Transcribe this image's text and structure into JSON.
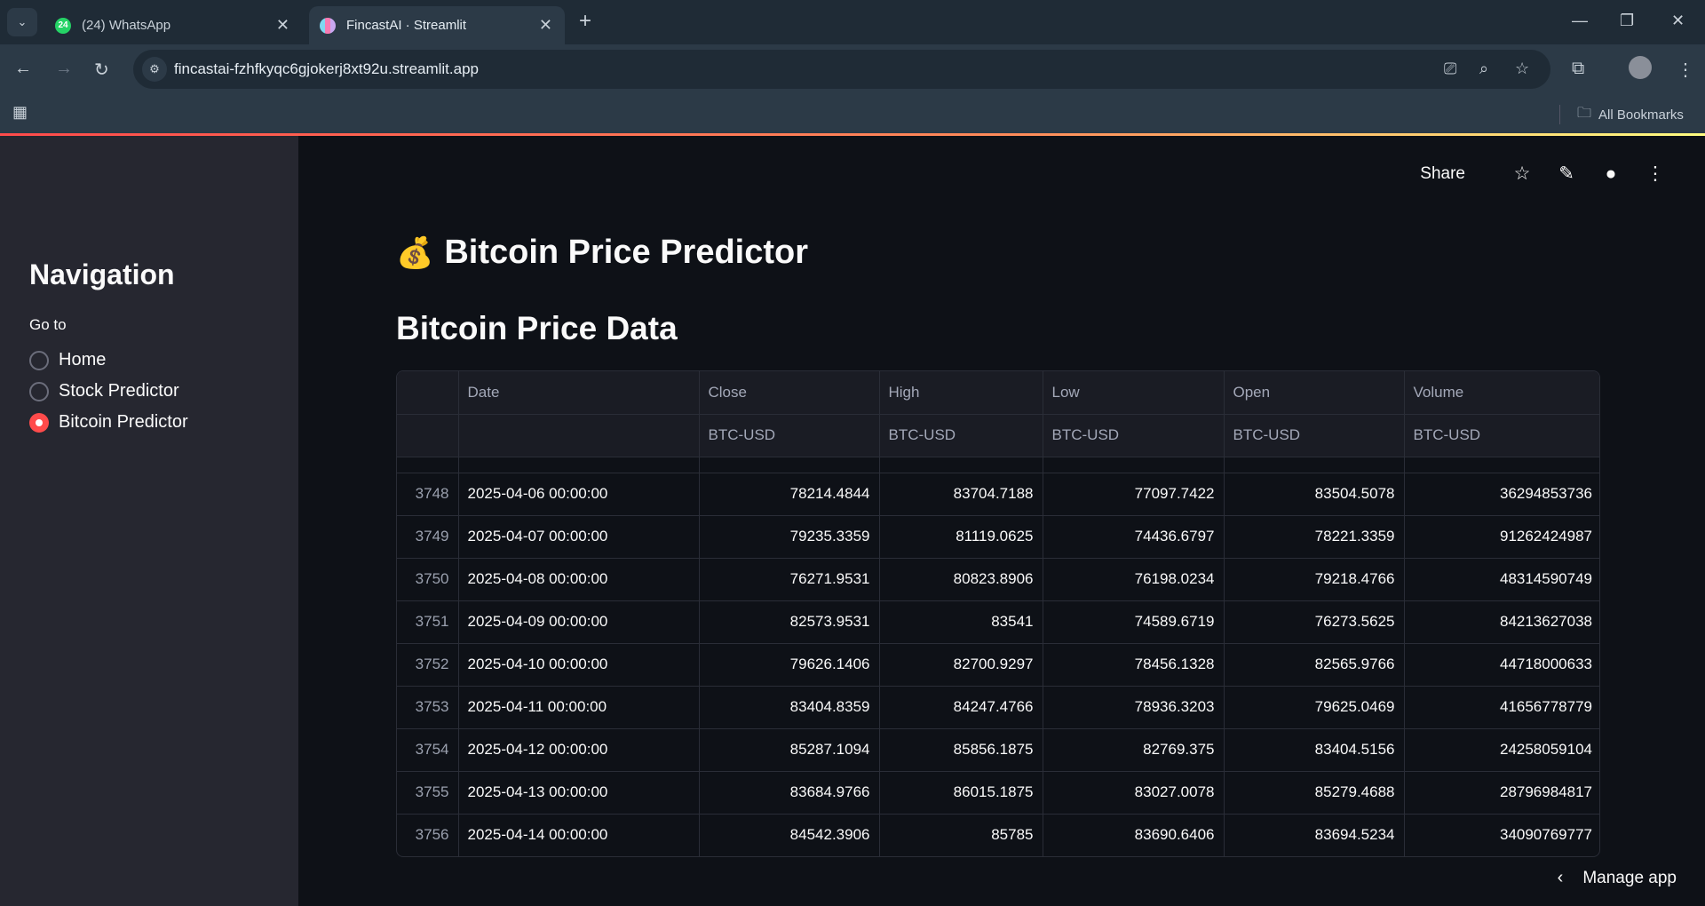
{
  "browser": {
    "tabs": [
      {
        "title": "(24) WhatsApp",
        "badge": "24"
      },
      {
        "title": "FincastAI · Streamlit"
      }
    ],
    "url": "fincastai-fzhfkyqc6gjokerj8xt92u.streamlit.app",
    "bookmarks_label": "All Bookmarks"
  },
  "sidebar": {
    "title": "Navigation",
    "goto_label": "Go to",
    "options": [
      {
        "label": "Home",
        "selected": false
      },
      {
        "label": "Stock Predictor",
        "selected": false
      },
      {
        "label": "Bitcoin Predictor",
        "selected": true
      }
    ]
  },
  "toolbar": {
    "share_label": "Share"
  },
  "page": {
    "title": "Bitcoin Price Predictor",
    "title_icon": "💰",
    "section_title": "Bitcoin Price Data"
  },
  "table": {
    "columns": [
      "",
      "Date",
      "Close",
      "High",
      "Low",
      "Open",
      "Volume"
    ],
    "subheaders": [
      "",
      "",
      "BTC-USD",
      "BTC-USD",
      "BTC-USD",
      "BTC-USD",
      "BTC-USD"
    ],
    "rows": [
      [
        "3748",
        "2025-04-06 00:00:00",
        "78214.4844",
        "83704.7188",
        "77097.7422",
        "83504.5078",
        "36294853736"
      ],
      [
        "3749",
        "2025-04-07 00:00:00",
        "79235.3359",
        "81119.0625",
        "74436.6797",
        "78221.3359",
        "91262424987"
      ],
      [
        "3750",
        "2025-04-08 00:00:00",
        "76271.9531",
        "80823.8906",
        "76198.0234",
        "79218.4766",
        "48314590749"
      ],
      [
        "3751",
        "2025-04-09 00:00:00",
        "82573.9531",
        "83541",
        "74589.6719",
        "76273.5625",
        "84213627038"
      ],
      [
        "3752",
        "2025-04-10 00:00:00",
        "79626.1406",
        "82700.9297",
        "78456.1328",
        "82565.9766",
        "44718000633"
      ],
      [
        "3753",
        "2025-04-11 00:00:00",
        "83404.8359",
        "84247.4766",
        "78936.3203",
        "79625.0469",
        "41656778779"
      ],
      [
        "3754",
        "2025-04-12 00:00:00",
        "85287.1094",
        "85856.1875",
        "82769.375",
        "83404.5156",
        "24258059104"
      ],
      [
        "3755",
        "2025-04-13 00:00:00",
        "83684.9766",
        "86015.1875",
        "83027.0078",
        "85279.4688",
        "28796984817"
      ],
      [
        "3756",
        "2025-04-14 00:00:00",
        "84542.3906",
        "85785",
        "83690.6406",
        "83694.5234",
        "34090769777"
      ]
    ]
  },
  "footer": {
    "manage_label": "Manage app"
  }
}
